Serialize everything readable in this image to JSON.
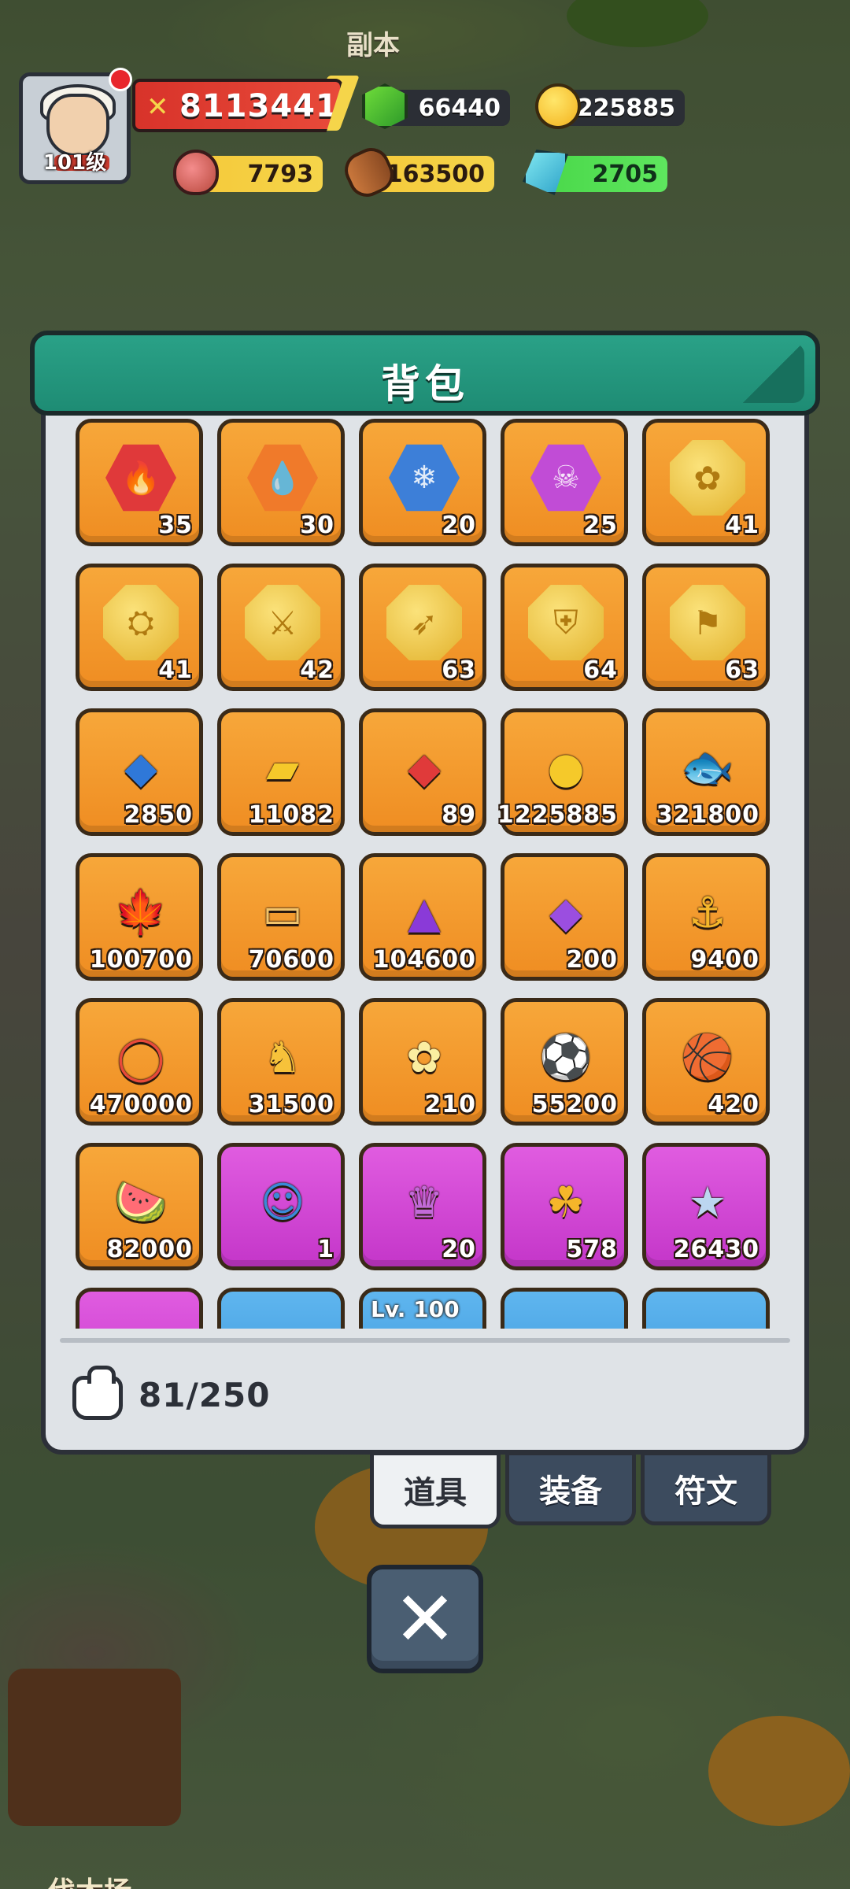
{
  "scene": {
    "top_label": "副本",
    "bottom_label": "伐木场"
  },
  "player": {
    "level_label": "101级",
    "power": "8113441"
  },
  "resources": {
    "gems": "66440",
    "gold": "225885",
    "meat": "7793",
    "wood": "1163500",
    "crystal": "2705"
  },
  "panel": {
    "title": "背包",
    "capacity": "81/250",
    "tabs": [
      "道具",
      "装备",
      "符文"
    ],
    "active_tab": "道具"
  },
  "items": [
    {
      "icon": "fire-rune",
      "count": "35",
      "rarity": "orange",
      "color": "#e0393a",
      "glyph": "🔥"
    },
    {
      "icon": "water-drop-rune",
      "count": "30",
      "rarity": "orange",
      "color": "#f07a2a",
      "glyph": "💧"
    },
    {
      "icon": "ice-rune",
      "count": "20",
      "rarity": "orange",
      "color": "#3d7fd8",
      "glyph": "❄"
    },
    {
      "icon": "skull-rune",
      "count": "25",
      "rarity": "orange",
      "color": "#c14cd6",
      "glyph": "☠"
    },
    {
      "icon": "nature-coin",
      "count": "41",
      "rarity": "orange",
      "color": "#f2c84a",
      "glyph": "✿"
    },
    {
      "icon": "wizard-hat-coin",
      "count": "41",
      "rarity": "orange",
      "color": "#f2c84a",
      "glyph": "⛭"
    },
    {
      "icon": "sword-coin",
      "count": "42",
      "rarity": "orange",
      "color": "#f2c84a",
      "glyph": "⚔"
    },
    {
      "icon": "bow-coin",
      "count": "63",
      "rarity": "orange",
      "color": "#f2c84a",
      "glyph": "➶"
    },
    {
      "icon": "shield-coin",
      "count": "64",
      "rarity": "orange",
      "color": "#f2c84a",
      "glyph": "⛨"
    },
    {
      "icon": "crossbow-coin",
      "count": "63",
      "rarity": "orange",
      "color": "#f2c84a",
      "glyph": "⚑"
    },
    {
      "icon": "blue-gem",
      "count": "2850",
      "rarity": "orange",
      "color": "#2f78d8",
      "glyph": "◆"
    },
    {
      "icon": "gold-ingot",
      "count": "11082",
      "rarity": "orange",
      "color": "#f5c92a",
      "glyph": "▰"
    },
    {
      "icon": "red-crystal",
      "count": "89",
      "rarity": "orange",
      "color": "#e03a3a",
      "glyph": "◆"
    },
    {
      "icon": "gold-coin",
      "count": "1225885",
      "rarity": "orange",
      "color": "#f5c92a",
      "glyph": "●"
    },
    {
      "icon": "white-fish",
      "count": "321800",
      "rarity": "orange",
      "color": "#f2ead0",
      "glyph": "🐟"
    },
    {
      "icon": "maple-leaf",
      "count": "100700",
      "rarity": "orange",
      "color": "#e8572a",
      "glyph": "🍁"
    },
    {
      "icon": "wood-scroll",
      "count": "70600",
      "rarity": "orange",
      "color": "#f3c46a",
      "glyph": "▭"
    },
    {
      "icon": "purple-shard",
      "count": "104600",
      "rarity": "orange",
      "color": "#8a3ad8",
      "glyph": "▲"
    },
    {
      "icon": "amethyst",
      "count": "200",
      "rarity": "orange",
      "color": "#9b4ee0",
      "glyph": "◆"
    },
    {
      "icon": "anchor",
      "count": "9400",
      "rarity": "orange",
      "color": "#f5b62a",
      "glyph": "⚓"
    },
    {
      "icon": "life-ring",
      "count": "470000",
      "rarity": "orange",
      "color": "#e84a3a",
      "glyph": "◯"
    },
    {
      "icon": "rocking-horse",
      "count": "31500",
      "rarity": "orange",
      "color": "#f7c23a",
      "glyph": "♞"
    },
    {
      "icon": "yellow-flower",
      "count": "210",
      "rarity": "orange",
      "color": "#fbeea0",
      "glyph": "✿"
    },
    {
      "icon": "soccer-ball",
      "count": "55200",
      "rarity": "orange",
      "color": "#ffffff",
      "glyph": "⚽"
    },
    {
      "icon": "basketball",
      "count": "420",
      "rarity": "orange",
      "color": "#e0702a",
      "glyph": "🏀"
    },
    {
      "icon": "watermelon",
      "count": "82000",
      "rarity": "orange",
      "color": "#e84a4a",
      "glyph": "🍉"
    },
    {
      "icon": "hero-card",
      "count": "1",
      "rarity": "purple",
      "color": "#3a8ad8",
      "glyph": "☺"
    },
    {
      "icon": "crown-card",
      "count": "20",
      "rarity": "purple",
      "color": "#c26ad8",
      "glyph": "♛"
    },
    {
      "icon": "four-leaf-clover",
      "count": "578",
      "rarity": "purple",
      "color": "#f5b62a",
      "glyph": "☘"
    },
    {
      "icon": "star-badge",
      "count": "26430",
      "rarity": "purple",
      "color": "#bcd6f0",
      "glyph": "★"
    },
    {
      "icon": "white-box",
      "count": "",
      "rarity": "purple",
      "color": "#f2ead0",
      "glyph": "▣"
    },
    {
      "icon": "red-scroll",
      "count": "",
      "rarity": "blue",
      "color": "#e84a4a",
      "glyph": "▭"
    },
    {
      "icon": "level-item",
      "count": "",
      "rarity": "blue",
      "color": "#f5c92a",
      "glyph": "",
      "tag": "Lv. 100"
    },
    {
      "icon": "green-gem",
      "count": "",
      "rarity": "blue",
      "color": "#4ad84a",
      "glyph": "◆"
    },
    {
      "icon": "green-clover",
      "count": "",
      "rarity": "blue",
      "color": "#4ad84a",
      "glyph": "☘"
    }
  ]
}
